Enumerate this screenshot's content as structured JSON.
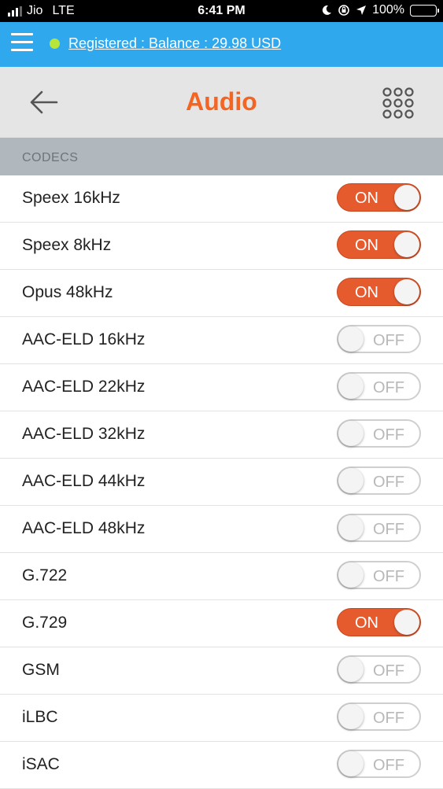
{
  "status_bar": {
    "carrier": "Jio",
    "network": "LTE",
    "time": "6:41 PM",
    "battery": "100%"
  },
  "top_bar": {
    "status_color": "#b7e63b",
    "balance_text": "Registered : Balance : 29.98 USD"
  },
  "title_bar": {
    "title": "Audio",
    "back_icon": "arrow-left-icon",
    "menu_icon": "grid-dots-icon"
  },
  "section": {
    "header": "CODECS"
  },
  "codecs": [
    {
      "name": "Speex 16kHz",
      "state": "ON"
    },
    {
      "name": "Speex 8kHz",
      "state": "ON"
    },
    {
      "name": "Opus 48kHz",
      "state": "ON"
    },
    {
      "name": "AAC-ELD 16kHz",
      "state": "OFF"
    },
    {
      "name": "AAC-ELD 22kHz",
      "state": "OFF"
    },
    {
      "name": "AAC-ELD 32kHz",
      "state": "OFF"
    },
    {
      "name": "AAC-ELD 44kHz",
      "state": "OFF"
    },
    {
      "name": "AAC-ELD 48kHz",
      "state": "OFF"
    },
    {
      "name": "G.722",
      "state": "OFF"
    },
    {
      "name": "G.729",
      "state": "ON"
    },
    {
      "name": "GSM",
      "state": "OFF"
    },
    {
      "name": "iLBC",
      "state": "OFF"
    },
    {
      "name": "iSAC",
      "state": "OFF"
    }
  ],
  "colors": {
    "top_bar": "#2fa8ee",
    "accent": "#f26522",
    "toggle_on": "#e55b2e"
  }
}
